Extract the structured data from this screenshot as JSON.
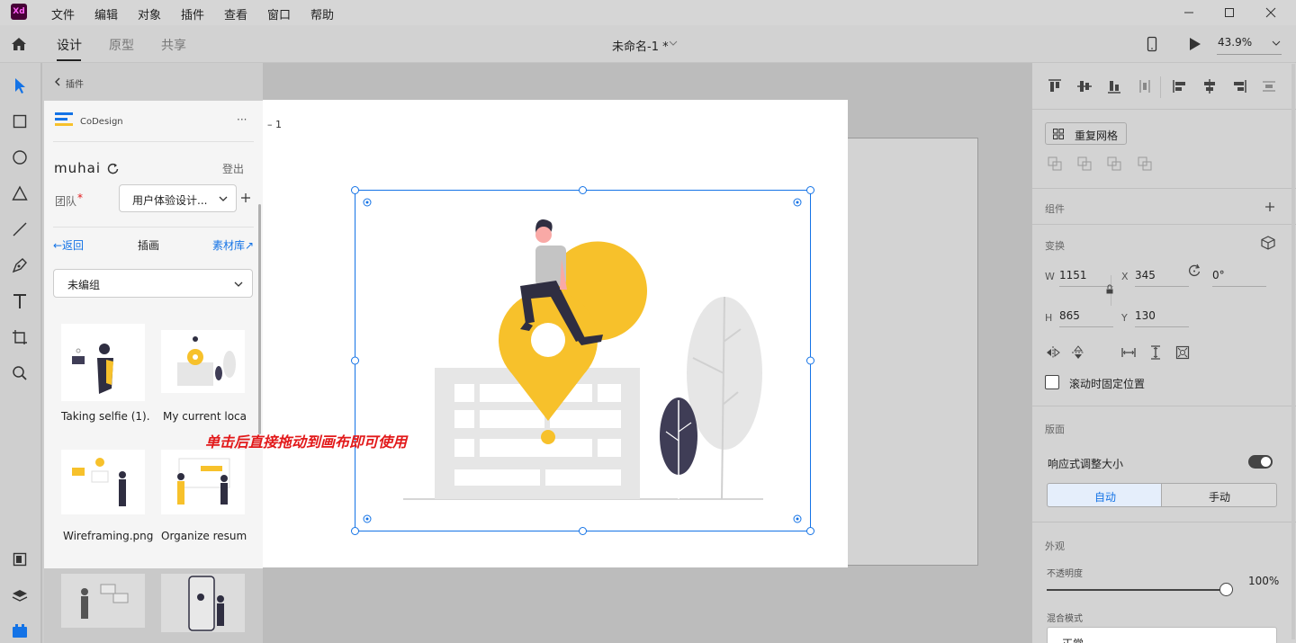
{
  "app": {
    "logo": "Xd",
    "menu": [
      "文件",
      "编辑",
      "对象",
      "插件",
      "查看",
      "窗口",
      "帮助"
    ]
  },
  "toolbar": {
    "tabs": [
      "设计",
      "原型",
      "共享"
    ],
    "doc_title": "未命名-1 *",
    "zoom": "43.9%"
  },
  "artboard": {
    "label": "– 1"
  },
  "plugin": {
    "back_label": "插件",
    "name": "CoDesign",
    "more": "···",
    "username": "muhai",
    "logout": "登出",
    "team_label": "团队",
    "team_required": "*",
    "team_value": "用户体验设计...",
    "nav_back": "←返回",
    "nav_title": "插画",
    "nav_library": "素材库↗",
    "group_select": "未编组",
    "items": [
      {
        "label": "Taking selfie (1)."
      },
      {
        "label": "My current loca"
      },
      {
        "label": "Wireframing.png"
      },
      {
        "label": "Organize resum"
      }
    ]
  },
  "hint": "单击后直接拖动到画布即可使用",
  "right": {
    "repeat_grid": "重复网格",
    "components": "组件",
    "transform": "变换",
    "w_label": "W",
    "w_value": "1151",
    "x_label": "X",
    "x_value": "345",
    "rotation": "0°",
    "h_label": "H",
    "h_value": "865",
    "y_label": "Y",
    "y_value": "130",
    "fixed_scroll": "滚动时固定位置",
    "layout": "版面",
    "responsive": "响应式调整大小",
    "auto": "自动",
    "manual": "手动",
    "appearance": "外观",
    "opacity_label": "不透明度",
    "opacity_value": "100%",
    "blend_label": "混合模式",
    "blend_value": "正常"
  },
  "colors": {
    "accent": "#1473e6",
    "yellow": "#f7c12b",
    "hint": "#e2191a",
    "dark": "#2f2e41"
  }
}
